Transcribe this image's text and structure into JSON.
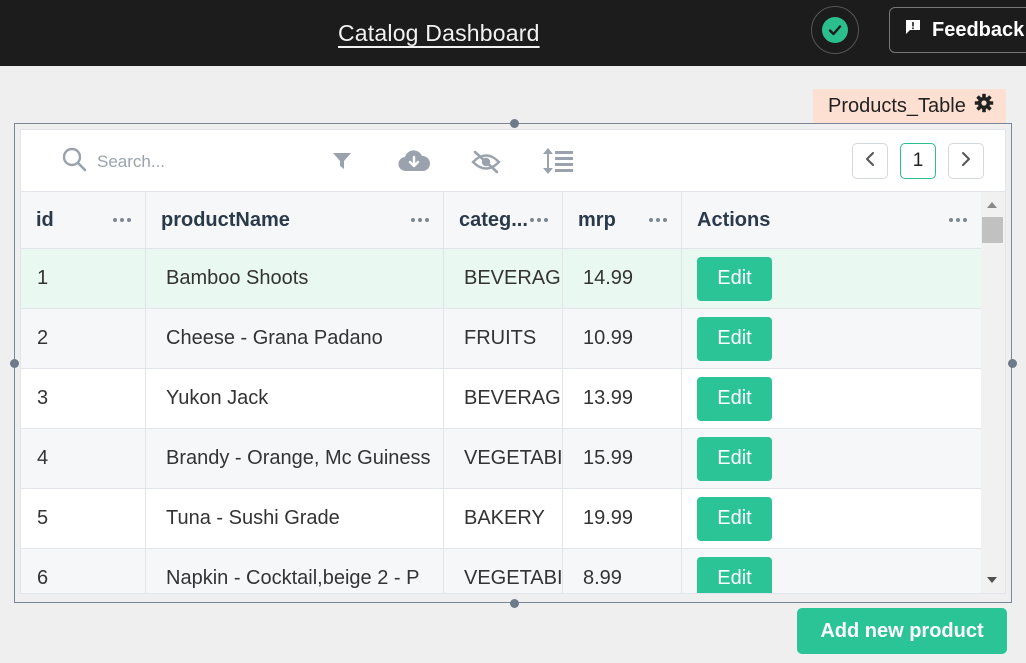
{
  "header": {
    "title": "Catalog Dashboard",
    "status_icon": "check-circle-icon",
    "feedback_label": "Feedback"
  },
  "widget": {
    "name": "Products_Table"
  },
  "toolbar": {
    "search_placeholder": "Search...",
    "icons": [
      "filter-icon",
      "download-icon",
      "eye-slash-icon",
      "row-height-icon"
    ]
  },
  "pagination": {
    "current_page": "1"
  },
  "table": {
    "columns": [
      "id",
      "productName",
      "categ...",
      "mrp",
      "Actions"
    ],
    "rows": [
      {
        "id": "1",
        "productName": "Bamboo Shoots",
        "category": "BEVERAG",
        "mrp": "14.99",
        "action": "Edit"
      },
      {
        "id": "2",
        "productName": "Cheese - Grana Padano",
        "category": "FRUITS",
        "mrp": "10.99",
        "action": "Edit"
      },
      {
        "id": "3",
        "productName": "Yukon Jack",
        "category": "BEVERAG",
        "mrp": "13.99",
        "action": "Edit"
      },
      {
        "id": "4",
        "productName": "Brandy - Orange, Mc Guiness",
        "category": "VEGETABI",
        "mrp": "15.99",
        "action": "Edit"
      },
      {
        "id": "5",
        "productName": "Tuna - Sushi Grade",
        "category": "BAKERY",
        "mrp": "19.99",
        "action": "Edit"
      },
      {
        "id": "6",
        "productName": "Napkin - Cocktail,beige 2 - P",
        "category": "VEGETABI",
        "mrp": "8.99",
        "action": "Edit"
      }
    ]
  },
  "actions": {
    "add_label": "Add new product"
  },
  "colors": {
    "accent": "#2bc496",
    "topbar": "#1c1c1c",
    "selected_row": "#e9f8f1",
    "widget_tag": "#fde0d2"
  }
}
